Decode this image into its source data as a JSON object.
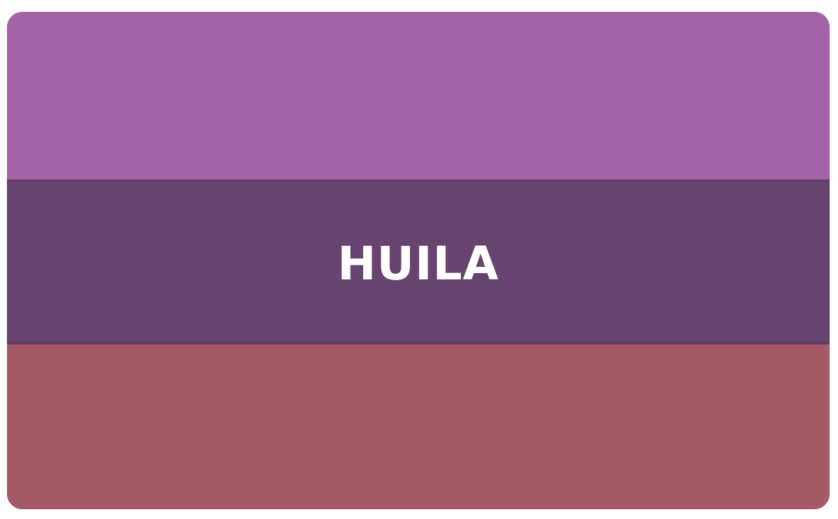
{
  "banner": {
    "title": "HUILA",
    "colors": {
      "top_stripe": "#a562a7",
      "middle_stripe": "#67446f",
      "bottom_stripe": "#a55a65",
      "text": "#ffffff",
      "background": "#ffffff"
    }
  }
}
